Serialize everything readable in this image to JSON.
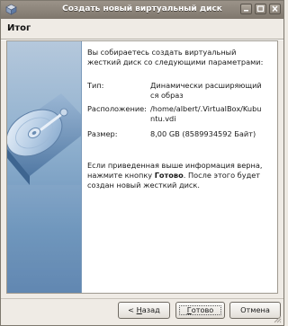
{
  "window": {
    "title": "Создать новый виртуальный диск"
  },
  "header": {
    "heading": "Итог"
  },
  "summary": {
    "intro": "Вы собираетесь создать виртуальный жесткий диск со следующими параметрами:",
    "params": [
      {
        "key": "Тип:",
        "value": "Динамически расширяющийся образ"
      },
      {
        "key": "Расположение:",
        "value": "/home/albert/.VirtualBox/Kubuntu.vdi"
      },
      {
        "key": "Размер:",
        "value": "8,00 GB (8589934592 Байт)"
      }
    ],
    "outro_before": "Если приведенная выше информация верна, нажмите кнопку ",
    "outro_bold": "Готово",
    "outro_after": ". После этого будет создан новый жесткий диск."
  },
  "buttons": {
    "back_prefix": "< ",
    "back_mnemonic": "Н",
    "back_rest": "азад",
    "finish_mnemonic": "Г",
    "finish_rest": "отово",
    "cancel": "Отмена"
  },
  "icons": {
    "app": "virtualbox-icon",
    "sidebar_image": "hard-disk-icon",
    "min": "minimize-icon",
    "max": "maximize-icon",
    "close": "close-icon"
  },
  "colors": {
    "titlebar": "#8a8278",
    "sidebar_top": "#b5c8dc",
    "sidebar_bottom": "#5b83ae"
  }
}
